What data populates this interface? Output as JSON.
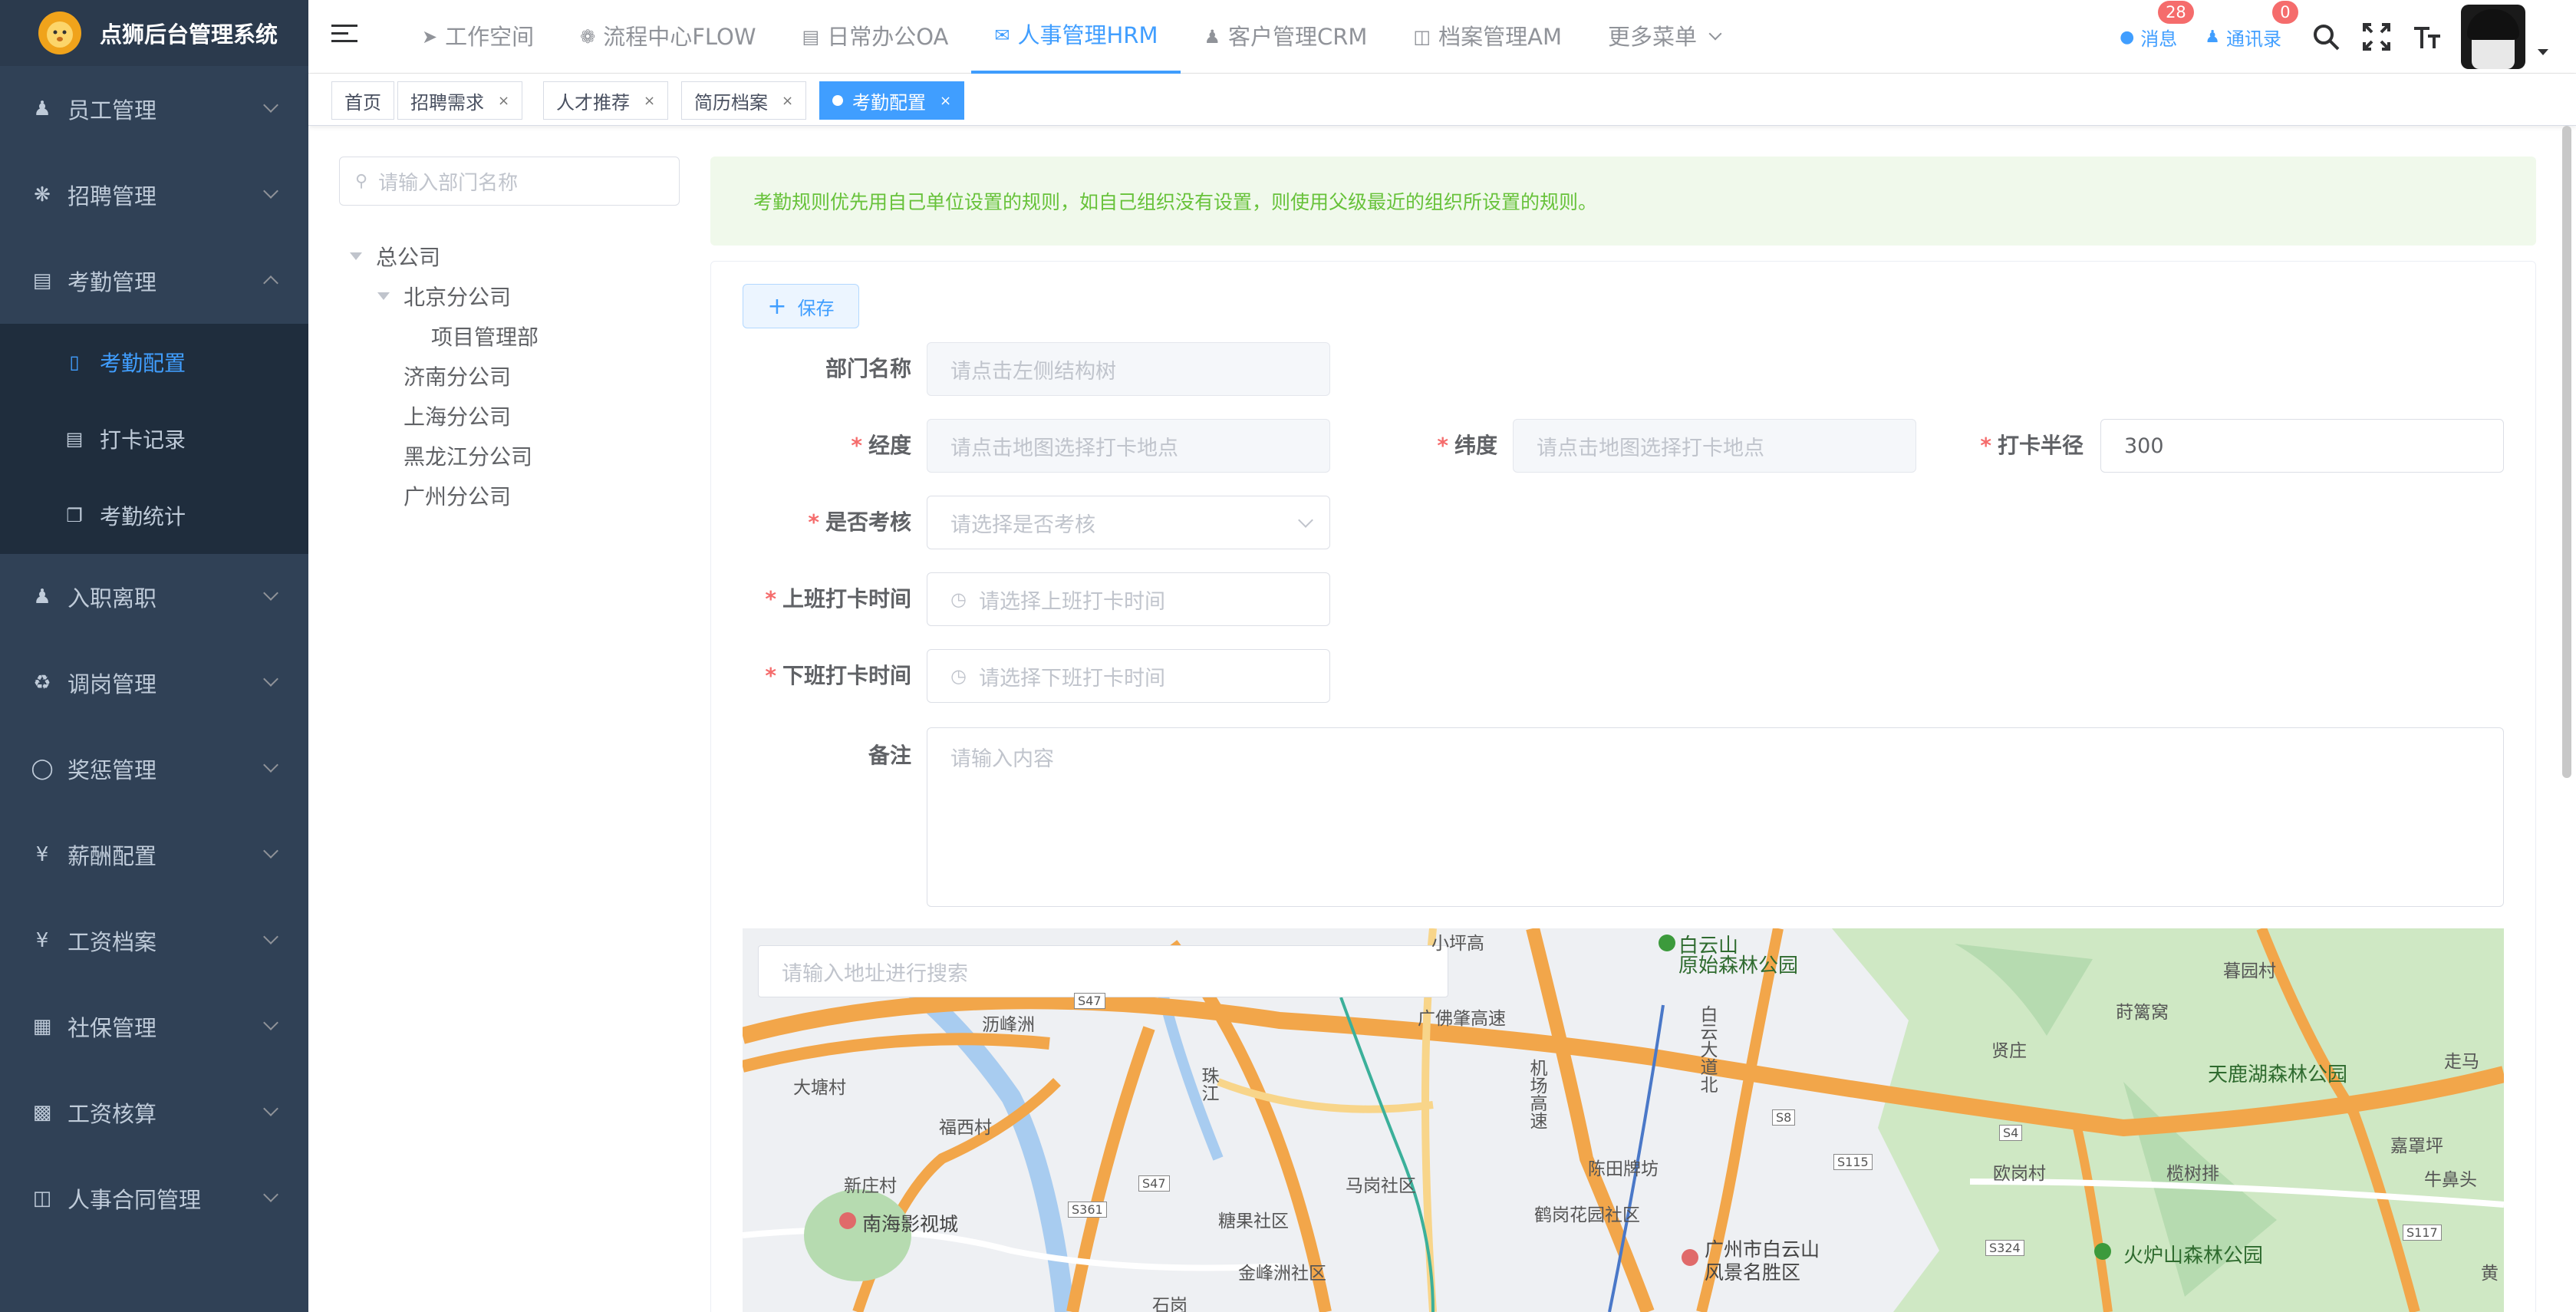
{
  "app": {
    "title": "点狮后台管理系统"
  },
  "sidebar": {
    "items": [
      {
        "label": "员工管理",
        "icon": "user-icon"
      },
      {
        "label": "招聘管理",
        "icon": "bug-icon"
      },
      {
        "label": "考勤管理",
        "icon": "document-icon",
        "expanded": true
      },
      {
        "label": "入职离职",
        "icon": "user-icon"
      },
      {
        "label": "调岗管理",
        "icon": "cart-icon"
      },
      {
        "label": "奖惩管理",
        "icon": "award-icon"
      },
      {
        "label": "薪酬配置",
        "icon": "yen-icon"
      },
      {
        "label": "工资档案",
        "icon": "yen-icon"
      },
      {
        "label": "社保管理",
        "icon": "grid-icon"
      },
      {
        "label": "工资核算",
        "icon": "calendar-icon"
      },
      {
        "label": "人事合同管理",
        "icon": "book-icon"
      }
    ],
    "sub_items": [
      {
        "label": "考勤配置",
        "icon": "mobile-icon",
        "active": true
      },
      {
        "label": "打卡记录",
        "icon": "document-icon"
      },
      {
        "label": "考勤统计",
        "icon": "copy-icon"
      }
    ]
  },
  "topnav": {
    "items": [
      {
        "label": "工作空间",
        "icon": "send-icon"
      },
      {
        "label": "流程中心FLOW",
        "icon": "cog-icon"
      },
      {
        "label": "日常办公OA",
        "icon": "document-icon"
      },
      {
        "label": "人事管理HRM",
        "icon": "chat-icon",
        "active": true
      },
      {
        "label": "客户管理CRM",
        "icon": "user-icon"
      },
      {
        "label": "档案管理AM",
        "icon": "book-icon"
      },
      {
        "label": "更多菜单",
        "icon": "chevron-down-icon"
      }
    ],
    "messages": {
      "label": "消息",
      "count": "28"
    },
    "contacts": {
      "label": "通讯录",
      "count": "0"
    }
  },
  "tags": [
    {
      "label": "首页"
    },
    {
      "label": "招聘需求"
    },
    {
      "label": "人才推荐"
    },
    {
      "label": "简历档案"
    },
    {
      "label": "考勤配置",
      "active": true
    }
  ],
  "tree": {
    "search_placeholder": "请输入部门名称",
    "nodes": [
      {
        "label": "总公司"
      },
      {
        "label": "北京分公司"
      },
      {
        "label": "项目管理部"
      },
      {
        "label": "济南分公司"
      },
      {
        "label": "上海分公司"
      },
      {
        "label": "黑龙江分公司"
      },
      {
        "label": "广州分公司"
      }
    ]
  },
  "alert": {
    "text": "考勤规则优先用自己单位设置的规则，如自己组织没有设置，则使用父级最近的组织所设置的规则。"
  },
  "form": {
    "save_label": "保存",
    "dept_label": "部门名称",
    "dept_placeholder": "请点击左侧结构树",
    "lng_label": "经度",
    "lng_placeholder": "请点击地图选择打卡地点",
    "lat_label": "纬度",
    "lat_placeholder": "请点击地图选择打卡地点",
    "radius_label": "打卡半径",
    "radius_value": "300",
    "assess_label": "是否考核",
    "assess_placeholder": "请选择是否考核",
    "on_label": "上班打卡时间",
    "on_placeholder": "请选择上班打卡时间",
    "off_label": "下班打卡时间",
    "off_placeholder": "请选择下班打卡时间",
    "remark_label": "备注",
    "remark_placeholder": "请输入内容"
  },
  "map": {
    "search_placeholder": "请输入地址进行搜索",
    "labels": [
      "白云山",
      "原始森林公园",
      "暮园村",
      "莳篱窝",
      "广佛肇高速",
      "贤庄",
      "天鹿湖森林公园",
      "走马",
      "机场高速",
      "白云大道北",
      "大塘村",
      "福西村",
      "珠江",
      "陈田牌坊",
      "欧岗村",
      "榄树排",
      "嘉罩坪",
      "牛鼻头",
      "新庄村",
      "马岗社区",
      "鹤岗花园社区",
      "南海影视城",
      "糖果社区",
      "广州市白云山风景名胜区",
      "火炉山森林公园",
      "金峰洲社区",
      "石岗",
      "黄",
      "沥峰洲",
      "小坪高"
    ],
    "roads": [
      "S47",
      "S8",
      "S4",
      "S115",
      "S361",
      "S47",
      "S117",
      "S324"
    ]
  }
}
